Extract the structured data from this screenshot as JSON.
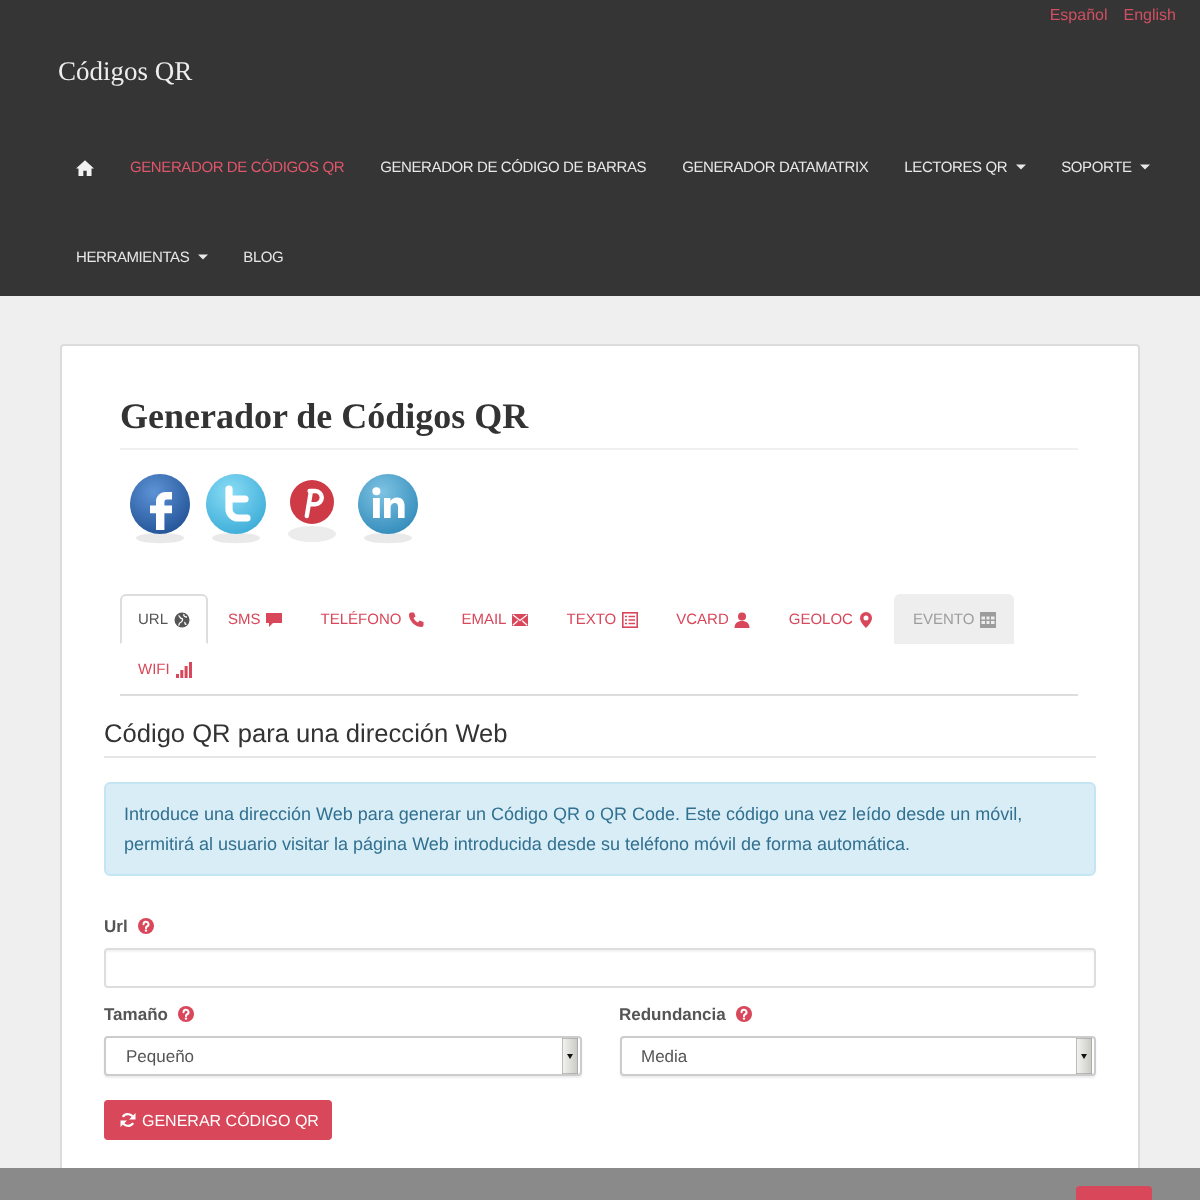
{
  "language_links": [
    {
      "label": "Español"
    },
    {
      "label": "English"
    }
  ],
  "brand": "Códigos QR",
  "nav": [
    {
      "kind": "home",
      "selected": false
    },
    {
      "kind": "link",
      "label": "GENERADOR DE CÓDIGOS QR",
      "selected": true
    },
    {
      "kind": "link",
      "label": "GENERADOR DE CÓDIGO DE BARRAS",
      "selected": false
    },
    {
      "kind": "link",
      "label": "GENERADOR DATAMATRIX",
      "selected": false
    },
    {
      "kind": "dropdown",
      "label": "LECTORES QR",
      "selected": false
    },
    {
      "kind": "dropdown",
      "label": "SOPORTE",
      "selected": false
    },
    {
      "kind": "dropdown",
      "label": "HERRAMIENTAS",
      "selected": false
    },
    {
      "kind": "link",
      "label": "BLOG",
      "selected": false
    }
  ],
  "page_title": "Generador de Códigos QR",
  "share_buttons": [
    {
      "kind": "facebook"
    },
    {
      "kind": "twitter"
    },
    {
      "kind": "pinterest"
    },
    {
      "kind": "linkedin"
    }
  ],
  "tabs": [
    {
      "label": "URL",
      "selected": true,
      "disabled": false
    },
    {
      "label": "SMS",
      "selected": false,
      "disabled": false
    },
    {
      "label": "TELÉFONO",
      "selected": false,
      "disabled": false
    },
    {
      "label": "EMAIL",
      "selected": false,
      "disabled": false
    },
    {
      "label": "TEXTO",
      "selected": false,
      "disabled": false
    },
    {
      "label": "VCARD",
      "selected": false,
      "disabled": false
    },
    {
      "label": "GEOLOC",
      "selected": false,
      "disabled": false
    },
    {
      "label": "EVENTO",
      "selected": false,
      "disabled": true
    },
    {
      "label": "WIFI",
      "selected": false,
      "disabled": false
    }
  ],
  "section_title": "Código QR para una dirección Web",
  "info_alert": "Introduce una dirección Web para generar un Código QR o QR Code. Este código una vez leído desde un móvil, permitirá al usuario visitar la página Web introducida desde su teléfono móvil de forma automática.",
  "form": {
    "url_field": {
      "label": "Url"
    },
    "selects": [
      {
        "label": "Tamaño",
        "value": "Pequeño"
      },
      {
        "label": "Redundancia",
        "value": "Media"
      }
    ],
    "button": {
      "label": "GENERAR CÓDIGO QR"
    }
  }
}
